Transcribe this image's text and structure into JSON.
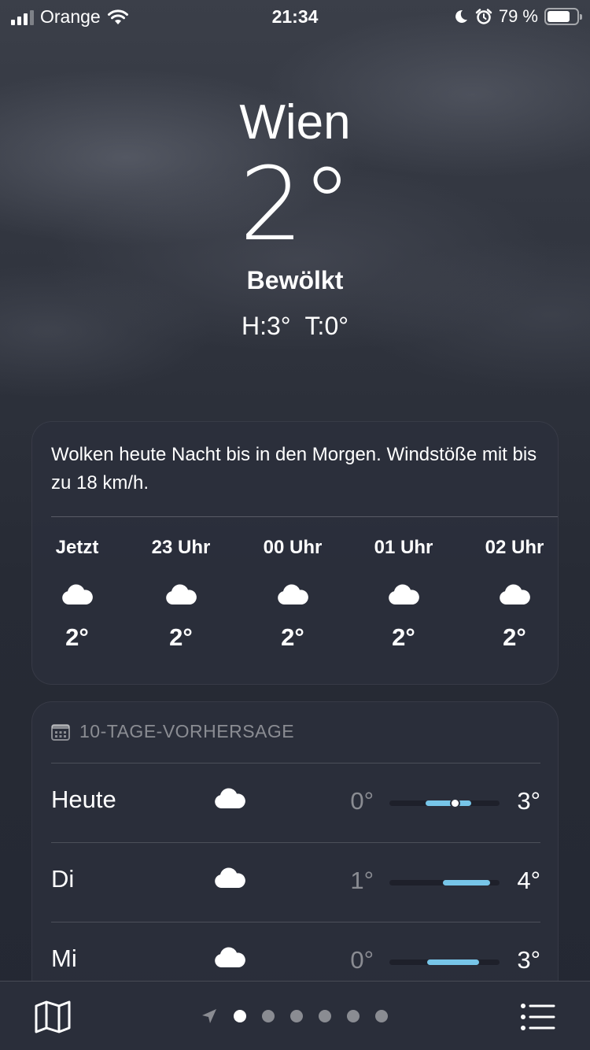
{
  "status": {
    "carrier": "Orange",
    "time": "21:34",
    "battery_text": "79 %",
    "battery_level": 0.79,
    "icons": [
      "signal-icon",
      "wifi-icon",
      "moon-icon",
      "alarm-icon",
      "battery-icon"
    ]
  },
  "header": {
    "city": "Wien",
    "temperature": "2°",
    "condition": "Bewölkt",
    "high": "H:3°",
    "low": "T:0°"
  },
  "hourly": {
    "summary": "Wolken heute Nacht bis in den Morgen. Windstöße mit bis zu 18 km/h.",
    "hours": [
      {
        "label": "Jetzt",
        "icon": "cloud-icon",
        "temp": "2°"
      },
      {
        "label": "23 Uhr",
        "icon": "cloud-icon",
        "temp": "2°"
      },
      {
        "label": "00 Uhr",
        "icon": "cloud-icon",
        "temp": "2°"
      },
      {
        "label": "01 Uhr",
        "icon": "cloud-icon",
        "temp": "2°"
      },
      {
        "label": "02 Uhr",
        "icon": "cloud-icon",
        "temp": "2°"
      }
    ]
  },
  "daily": {
    "title": "10-TAGE-VORHERSAGE",
    "title_icon": "calendar-icon",
    "days": [
      {
        "name": "Heute",
        "icon": "cloud-icon",
        "low": "0°",
        "high": "3°",
        "current_marker": true
      },
      {
        "name": "Di",
        "icon": "cloud-icon",
        "low": "1°",
        "high": "4°"
      },
      {
        "name": "Mi",
        "icon": "cloud-icon",
        "low": "0°",
        "high": "3°"
      }
    ]
  },
  "bottom_bar": {
    "left_icon": "map-icon",
    "right_icon": "list-icon",
    "page_count": 6,
    "active_page": 1,
    "location_icon": "location-arrow-icon"
  },
  "colors": {
    "temp_bar": "#77c5e8",
    "card_bg": "#2c303c",
    "sky": "#2f333d"
  }
}
